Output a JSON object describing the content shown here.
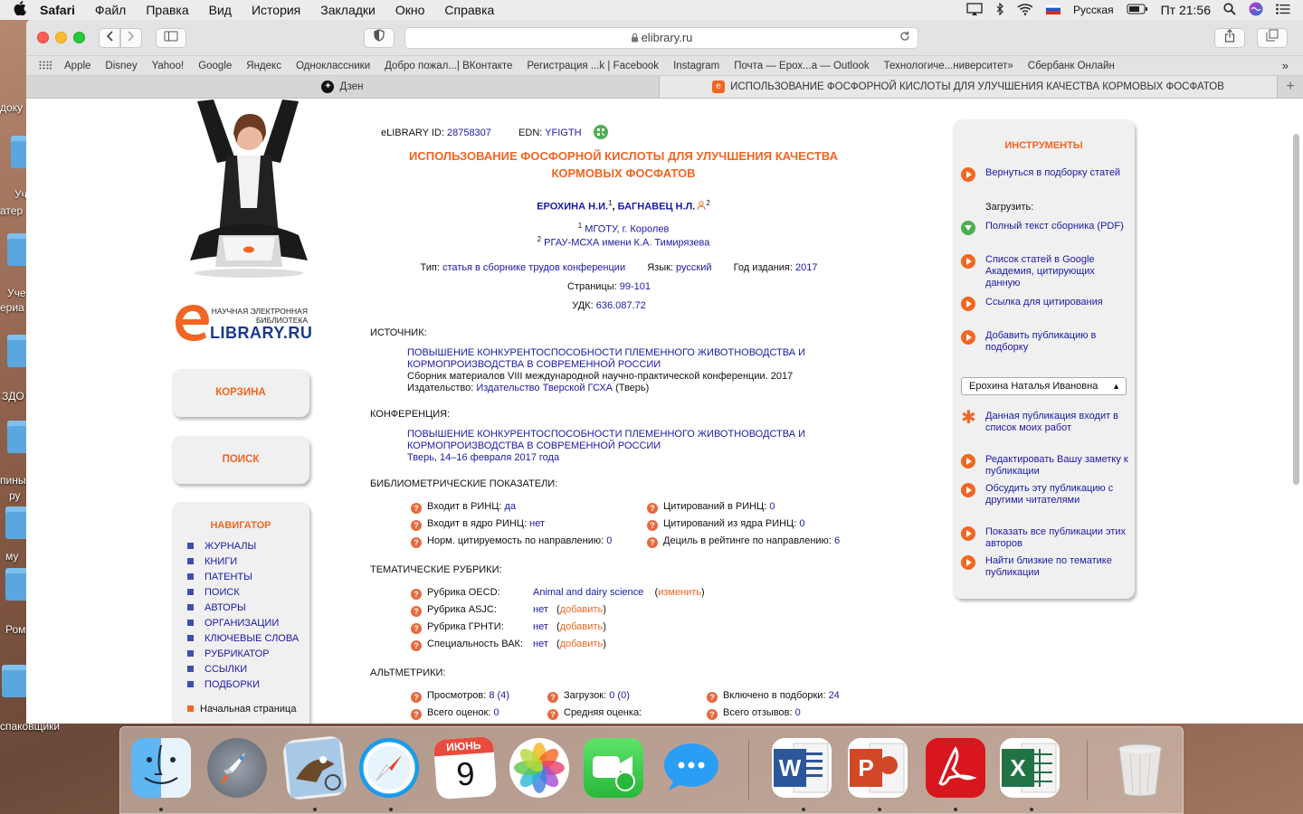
{
  "menubar": {
    "apple": "",
    "app": "Safari",
    "items": [
      "Файл",
      "Правка",
      "Вид",
      "История",
      "Закладки",
      "Окно",
      "Справка"
    ],
    "input_lang": "Русская",
    "clock": "Пт 21:56"
  },
  "desktop": {
    "labels": [
      "доку",
      "Уч",
      "атер",
      "Уче",
      "ериа",
      "ЗДО",
      "пины",
      "ру",
      "му",
      "Ром",
      "спаковщики"
    ]
  },
  "browser": {
    "url": "elibrary.ru",
    "favorites": [
      "Apple",
      "Disney",
      "Yahoo!",
      "Google",
      "Яндекс",
      "Одноклассники",
      "Добро пожал...| ВКонтакте",
      "Регистрация ...k | Facebook",
      "Instagram",
      "Почта — Ерох...а — Outlook",
      "Технологиче...ниверситет»",
      "Сбербанк Онлайн"
    ],
    "tabs": [
      {
        "label": "Дзен",
        "active": false
      },
      {
        "label": "ИСПОЛЬЗОВАНИЕ ФОСФОРНОЙ КИСЛОТЫ ДЛЯ УЛУЧШЕНИЯ КАЧЕСТВА КОРМОВЫХ ФОСФАТОВ",
        "active": true
      }
    ]
  },
  "left": {
    "logo_small": "НАУЧНАЯ ЭЛЕКТРОННАЯ БИБЛИОТЕКА",
    "logo_big": "LIBRARY.RU",
    "logo_e": "e",
    "cart": "КОРЗИНА",
    "search": "ПОИСК",
    "nav_title": "НАВИГАТОР",
    "nav_items": [
      "ЖУРНАЛЫ",
      "КНИГИ",
      "ПАТЕНТЫ",
      "ПОИСК",
      "АВТОРЫ",
      "ОРГАНИЗАЦИИ",
      "КЛЮЧЕВЫЕ СЛОВА",
      "РУБРИКАТОР",
      "ССЫЛКИ",
      "ПОДБОРКИ"
    ],
    "home": "Начальная страница"
  },
  "article": {
    "id_label": "eLIBRARY ID:",
    "id_value": "28758307",
    "edn_label": "EDN:",
    "edn_value": "YFIGTH",
    "title_1": "ИСПОЛЬЗОВАНИЕ ФОСФОРНОЙ КИСЛОТЫ ДЛЯ УЛУЧШЕНИЯ КАЧЕСТВА",
    "title_2": "КОРМОВЫХ ФОСФАТОВ",
    "author1": "ЕРОХИНА Н.И.",
    "author1_sup": "1",
    "author2": "БАГНАВЕЦ Н.Л.",
    "author2_sup": "2",
    "aff1_sup": "1",
    "aff1": "МГОТУ, г. Королев",
    "aff2_sup": "2",
    "aff2": "РГАУ-МСХА имени К.А. Тимирязева",
    "type_label": "Тип:",
    "type_value": "статья в сборнике трудов конференции",
    "lang_label": "Язык:",
    "lang_value": "русский",
    "year_label": "Год издания:",
    "year_value": "2017",
    "pages_label": "Страницы:",
    "pages_value": "99-101",
    "udk_label": "УДК:",
    "udk_value": "636.087.72",
    "source_h": "ИСТОЧНИК:",
    "source_title_1": "ПОВЫШЕНИЕ КОНКУРЕНТОСПОСОБНОСТИ ПЛЕМЕННОГО ЖИВОТНОВОДСТВА И",
    "source_title_2": "КОРМОПРОИЗВОДСТВА В СОВРЕМЕННОЙ РОССИИ",
    "source_desc": "Сборник материалов VIII международной научно-практической конференции. 2017",
    "publisher_label": "Издательство:",
    "publisher_value": "Издательство Тверской ГСХА",
    "publisher_city": "(Тверь)",
    "conf_h": "КОНФЕРЕНЦИЯ:",
    "conf_title_1": "ПОВЫШЕНИЕ КОНКУРЕНТОСПОСОБНОСТИ ПЛЕМЕННОГО ЖИВОТНОВОДСТВА И",
    "conf_title_2": "КОРМОПРОИЗВОДСТВА В СОВРЕМЕННОЙ РОССИИ",
    "conf_date": "Тверь, 14–16 февраля 2017 года",
    "biblio_h": "БИБЛИОМЕТРИЧЕСКИЕ ПОКАЗАТЕЛИ:",
    "biblio_left": [
      {
        "label": "Входит в РИНЦ:",
        "value": "да"
      },
      {
        "label": "Входит в ядро РИНЦ:",
        "value": "нет"
      },
      {
        "label": "Норм. цитируемость по направлению:",
        "value": "0"
      }
    ],
    "biblio_right": [
      {
        "label": "Цитирований в РИНЦ:",
        "value": "0"
      },
      {
        "label": "Цитирований из ядра РИНЦ:",
        "value": "0"
      },
      {
        "label": "Дециль в рейтинге по направлению:",
        "value": "6"
      }
    ],
    "rubrics_h": "ТЕМАТИЧЕСКИЕ РУБРИКИ:",
    "rubrics": [
      {
        "label": "Рубрика OECD:",
        "value": "Animal and dairy science",
        "action": "изменить"
      },
      {
        "label": "Рубрика ASJC:",
        "value": "нет",
        "action": "добавить"
      },
      {
        "label": "Рубрика ГРНТИ:",
        "value": "нет",
        "action": "добавить"
      },
      {
        "label": "Специальность ВАК:",
        "value": "нет",
        "action": "добавить"
      }
    ],
    "alt_h": "АЛЬТМЕТРИКИ:",
    "alt_views_label": "Просмотров:",
    "alt_views_value": "8 (4)",
    "alt_downloads_label": "Загрузок:",
    "alt_downloads_value": "0 (0)",
    "alt_included_label": "Включено в подборки:",
    "alt_included_value": "24",
    "alt_ratings_label": "Всего оценок:",
    "alt_ratings_value": "0",
    "alt_avg_label": "Средняя оценка:",
    "alt_reviews_label": "Всего отзывов:",
    "alt_reviews_value": "0"
  },
  "tools": {
    "title": "ИНСТРУМЕНТЫ",
    "back": "Вернуться в подборку статей",
    "download_label": "Загрузить:",
    "fulltext": "Полный текст сборника (PDF)",
    "google": "Список статей в Google Академия, цитирующих данную",
    "cite": "Ссылка для цитирования",
    "add_to": "Добавить публикацию в подборку",
    "select_value": "Ерохина Наталья Ивановна",
    "my_works": "Данная публикация входит в список моих работ",
    "edit_note": "Редактировать Вашу заметку к публикации",
    "discuss": "Обсудить эту публикацию с другими читателями",
    "show_all": "Показать все публикации этих авторов",
    "similar": "Найти близкие по тематике публикации"
  },
  "dock": {
    "calendar_month": "ИЮНЬ",
    "calendar_day": "9"
  }
}
